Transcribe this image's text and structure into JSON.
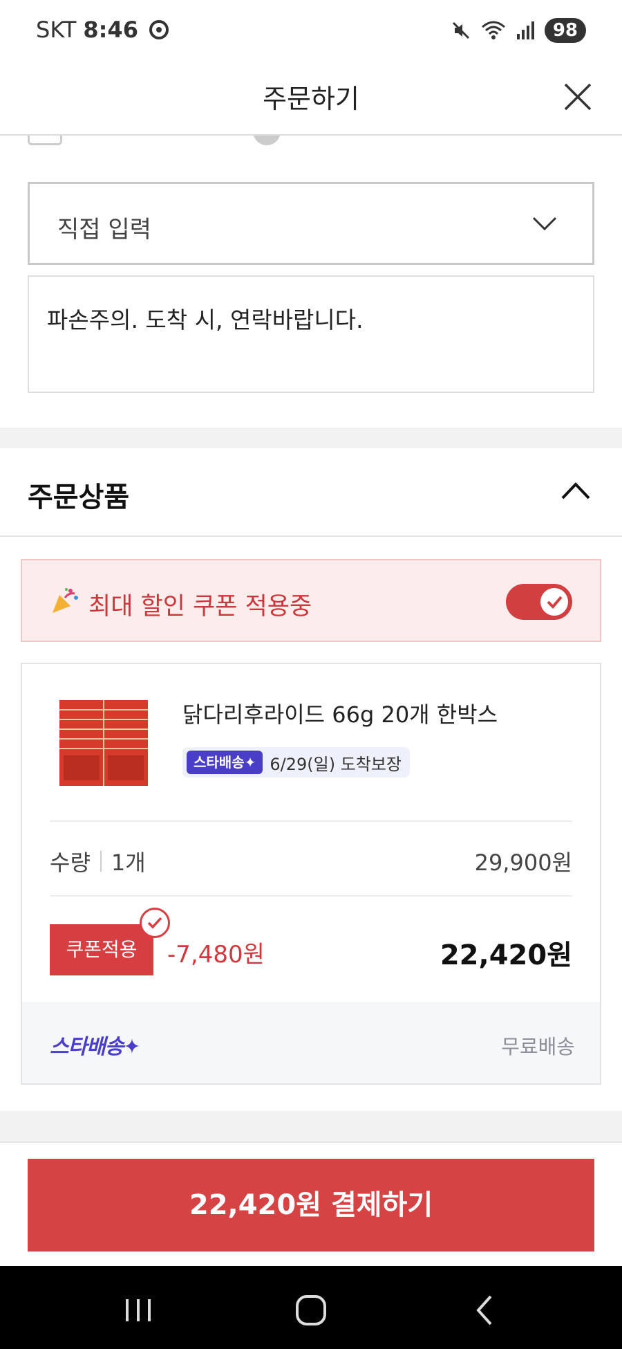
{
  "status_bar": {
    "carrier": "SKT",
    "time": "8:46",
    "battery": "98"
  },
  "header": {
    "title": "주문하기"
  },
  "delivery_request": {
    "select_value": "직접 입력",
    "memo_text": "파손주의. 도착 시, 연락바랍니다."
  },
  "order_items": {
    "section_title": "주문상품",
    "coupon_banner": {
      "text": "최대 할인 쿠폰 적용중",
      "toggle_on": true
    },
    "product": {
      "name": "닭다리후라이드 66g 20개 한박스",
      "delivery_badge": "스타배송✦",
      "delivery_date": "6/29(일) 도착보장",
      "quantity_label": "수량",
      "quantity_value": "1개",
      "original_price": "29,900원",
      "coupon_button": "쿠폰적용",
      "discount": "-7,480원",
      "final_price": "22,420원"
    },
    "shipping": {
      "logo_text": "스타배송✦",
      "fee_text": "무료배송"
    }
  },
  "pay_button": "22,420원 결제하기",
  "colors": {
    "accent_red": "#d64345",
    "star_purple": "#4a3dc7",
    "banner_bg": "#fcecec"
  }
}
